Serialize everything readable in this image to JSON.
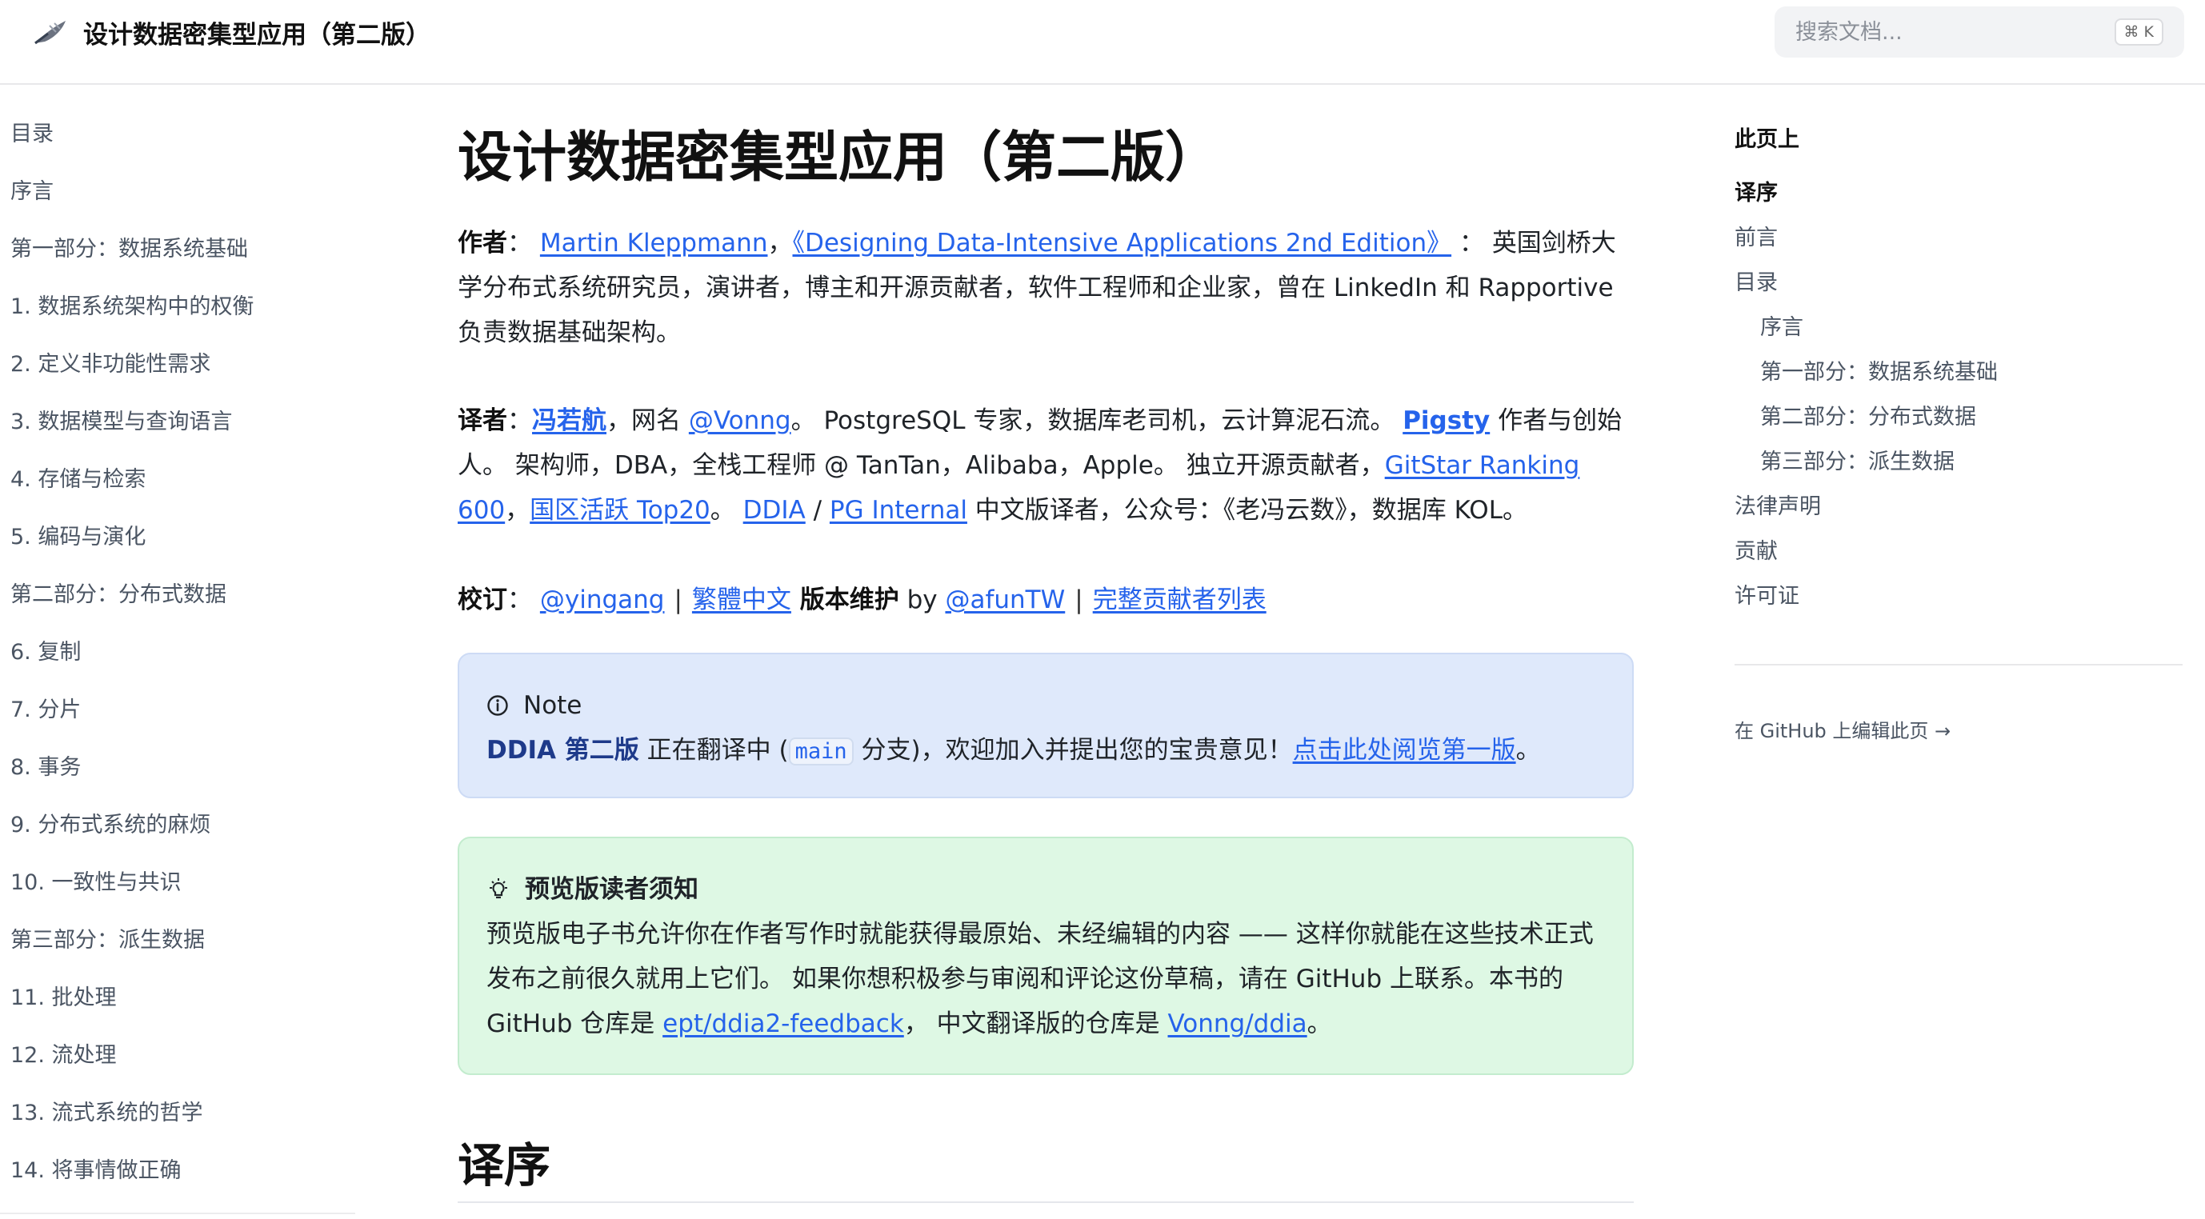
{
  "header": {
    "title": "设计数据密集型应用（第二版）",
    "search_placeholder": "搜索文档...",
    "search_shortcut": "⌘ K"
  },
  "sidebar": {
    "items": [
      "目录",
      "序言",
      "第一部分：数据系统基础",
      "1. 数据系统架构中的权衡",
      "2. 定义非功能性需求",
      "3. 数据模型与查询语言",
      "4. 存储与检索",
      "5. 编码与演化",
      "第二部分：分布式数据",
      "6. 复制",
      "7. 分片",
      "8. 事务",
      "9. 分布式系统的麻烦",
      "10. 一致性与共识",
      "第三部分：派生数据",
      "11. 批处理",
      "12. 流处理",
      "13. 流式系统的哲学",
      "14. 将事情做正确"
    ]
  },
  "main": {
    "title": "设计数据密集型应用（第二版）",
    "author": {
      "label": "作者",
      "colon": "：",
      "name": "Martin Kleppmann",
      "comma": "，",
      "book": "《Designing Data-Intensive Applications 2nd Edition》",
      "colon2": " ： ",
      "desc": "英国剑桥大学分布式系统研究员，演讲者，博主和开源贡献者，软件工程师和企业家，曾在 LinkedIn 和 Rapportive 负责数据基础架构。"
    },
    "translator": {
      "label": "译者",
      "colon": "：",
      "name": "冯若航",
      "t1": "，网名 ",
      "handle": "@Vonng",
      "t2": "。 PostgreSQL 专家，数据库老司机，云计算泥石流。 ",
      "pigsty": "Pigsty",
      "t3": " 作者与创始人。 架构师，DBA，全栈工程师 @ TanTan，Alibaba，Apple。 独立开源贡献者，",
      "gitstar": "GitStar Ranking 600",
      "t4": "，",
      "top20": "国区活跃 Top20",
      "t5": "。 ",
      "ddia": "DDIA",
      "slash": " / ",
      "pg": "PG Internal",
      "t6": " 中文版译者，公众号：《老冯云数》，数据库 KOL。"
    },
    "reviewer": {
      "label": "校订",
      "colon": "：",
      "yingang": "@yingang",
      "sep": "|",
      "trad": "繁體中文",
      "maint": " 版本维护",
      "by": " by ",
      "afun": "@afunTW",
      "contributors": "完整贡献者列表"
    },
    "note": {
      "title": "Note",
      "bold": "DDIA 第二版",
      "t1": " 正在翻译中 (",
      "branch": "main",
      "t2": " 分支)，欢迎加入并提出您的宝贵意见！",
      "link": "点击此处阅览第一版",
      "t3": "。"
    },
    "tip": {
      "title": "预览版读者须知",
      "t1": "预览版电子书允许你在作者写作时就能获得最原始、未经编辑的内容 —— 这样你就能在这些技术正式发布之前很久就用上它们。 如果你想积极参与审阅和评论这份草稿，请在 GitHub 上联系。本书的 GitHub 仓库是 ",
      "repo1": "ept/ddia2-feedback",
      "t2": "， 中文翻译版的仓库是 ",
      "repo2": "Vonng/ddia",
      "t3": "。"
    },
    "h2": "译序"
  },
  "toc": {
    "title": "此页上",
    "items": [
      {
        "label": "译序",
        "active": true,
        "indent": false
      },
      {
        "label": "前言",
        "active": false,
        "indent": false
      },
      {
        "label": "目录",
        "active": false,
        "indent": false
      },
      {
        "label": "序言",
        "active": false,
        "indent": true
      },
      {
        "label": "第一部分：数据系统基础",
        "active": false,
        "indent": true
      },
      {
        "label": "第二部分：分布式数据",
        "active": false,
        "indent": true
      },
      {
        "label": "第三部分：派生数据",
        "active": false,
        "indent": true
      },
      {
        "label": "法律声明",
        "active": false,
        "indent": false
      },
      {
        "label": "贡献",
        "active": false,
        "indent": false
      },
      {
        "label": "许可证",
        "active": false,
        "indent": false
      }
    ],
    "edit_link": "在 GitHub 上编辑此页 →"
  },
  "colors": {
    "link": "#2563eb",
    "note_bg": "#dfe9fb",
    "tip_bg": "#def8e4"
  }
}
